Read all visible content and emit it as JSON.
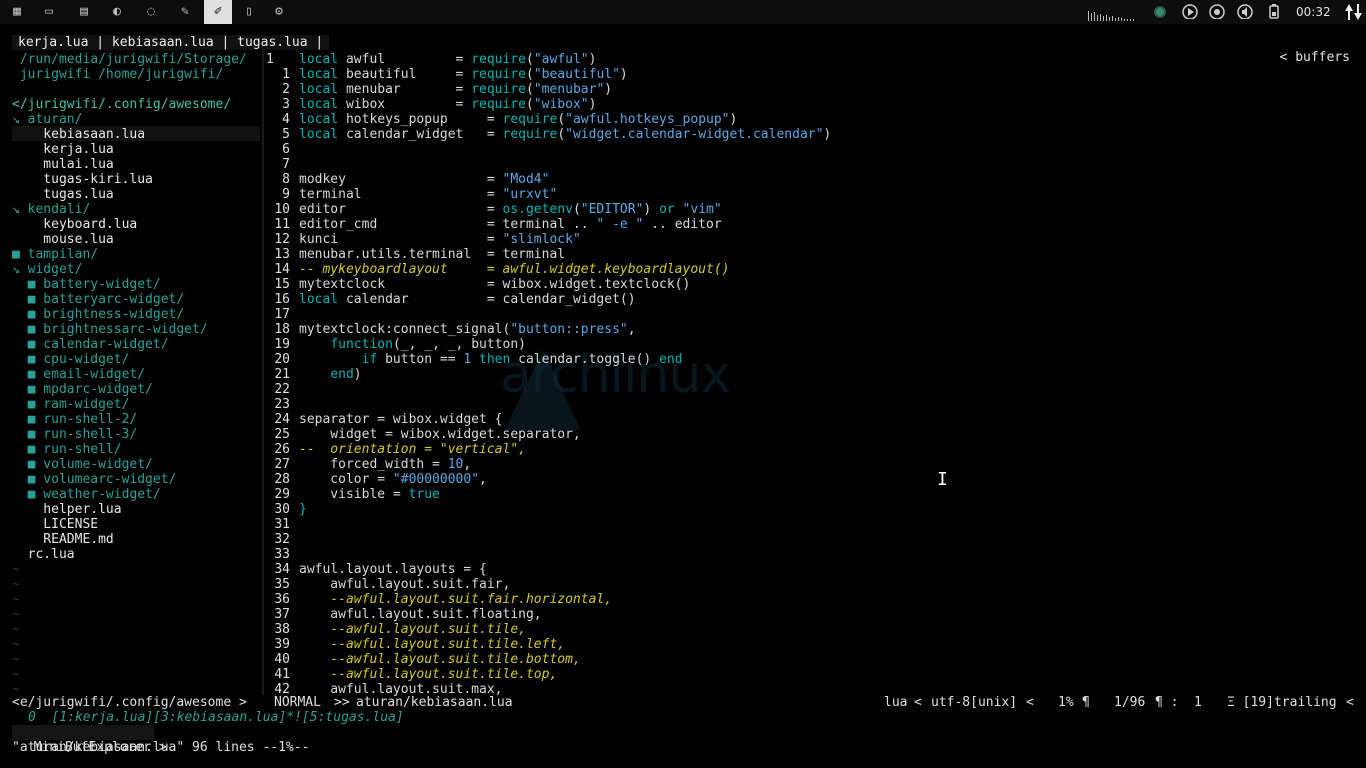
{
  "topbar": {
    "tags": [
      "grid-icon",
      "drive-icon",
      "film-icon",
      "chart-icon",
      "chat-icon",
      "brush-icon",
      "pen-icon",
      "document-icon",
      "gear-icon"
    ],
    "active_tag_index": 6,
    "clock": "00:32"
  },
  "tabline": {
    "tabs": "kerja.lua | kebiasaan.lua | tugas.lua |",
    "buffers": "buffers"
  },
  "tree": [
    {
      "text": " /run/media/jurigwifi/Storage/",
      "cls": "dir"
    },
    {
      "text": " jurigwifi /home/jurigwifi/",
      "cls": "dir"
    },
    {
      "text": "",
      "cls": "file"
    },
    {
      "text": "</jurigwifi/.config/awesome/",
      "cls": "root"
    },
    {
      "text": "↘ aturan/",
      "cls": "dir"
    },
    {
      "text": "    kebiasaan.lua",
      "cls": "file"
    },
    {
      "text": "    kerja.lua",
      "cls": "file"
    },
    {
      "text": "    mulai.lua",
      "cls": "file"
    },
    {
      "text": "    tugas-kiri.lua",
      "cls": "file"
    },
    {
      "text": "    tugas.lua",
      "cls": "file"
    },
    {
      "text": "↘ kendali/",
      "cls": "dir"
    },
    {
      "text": "    keyboard.lua",
      "cls": "file"
    },
    {
      "text": "    mouse.lua",
      "cls": "file"
    },
    {
      "text": "■ tampilan/",
      "cls": "dir"
    },
    {
      "text": "↘ widget/",
      "cls": "dir"
    },
    {
      "text": "  ■ battery-widget/",
      "cls": "dir"
    },
    {
      "text": "  ■ batteryarc-widget/",
      "cls": "dir"
    },
    {
      "text": "  ■ brightness-widget/",
      "cls": "dir"
    },
    {
      "text": "  ■ brightnessarc-widget/",
      "cls": "dir"
    },
    {
      "text": "  ■ calendar-widget/",
      "cls": "dir"
    },
    {
      "text": "  ■ cpu-widget/",
      "cls": "dir"
    },
    {
      "text": "  ■ email-widget/",
      "cls": "dir"
    },
    {
      "text": "  ■ mpdarc-widget/",
      "cls": "dir"
    },
    {
      "text": "  ■ ram-widget/",
      "cls": "dir"
    },
    {
      "text": "  ■ run-shell-2/",
      "cls": "dir"
    },
    {
      "text": "  ■ run-shell-3/",
      "cls": "dir"
    },
    {
      "text": "  ■ run-shell/",
      "cls": "dir"
    },
    {
      "text": "  ■ volume-widget/",
      "cls": "dir"
    },
    {
      "text": "  ■ volumearc-widget/",
      "cls": "dir"
    },
    {
      "text": "  ■ weather-widget/",
      "cls": "dir"
    },
    {
      "text": "    helper.lua",
      "cls": "file"
    },
    {
      "text": "    LICENSE",
      "cls": "file"
    },
    {
      "text": "    README.md",
      "cls": "file"
    },
    {
      "text": "  rc.lua",
      "cls": "file"
    },
    {
      "text": "~",
      "cls": "tilde"
    },
    {
      "text": "~",
      "cls": "tilde"
    },
    {
      "text": "~",
      "cls": "tilde"
    },
    {
      "text": "~",
      "cls": "tilde"
    },
    {
      "text": "~",
      "cls": "tilde"
    },
    {
      "text": "~",
      "cls": "tilde"
    },
    {
      "text": "~",
      "cls": "tilde"
    },
    {
      "text": "~",
      "cls": "tilde"
    },
    {
      "text": "~",
      "cls": "tilde"
    }
  ],
  "code": [
    {
      "ln": "1",
      "parts": [
        [
          "kw",
          "local"
        ],
        [
          "",
          " awful         = "
        ],
        [
          "kw",
          "require"
        ],
        [
          "",
          "("
        ],
        [
          "str",
          "\"awful\""
        ],
        [
          "",
          ")"
        ]
      ]
    },
    {
      "ln": "1",
      "parts": [
        [
          "kw",
          "local"
        ],
        [
          "",
          " beautiful     = "
        ],
        [
          "kw",
          "require"
        ],
        [
          "",
          "("
        ],
        [
          "str",
          "\"beautiful\""
        ],
        [
          "",
          ")"
        ]
      ]
    },
    {
      "ln": "2",
      "parts": [
        [
          "kw",
          "local"
        ],
        [
          "",
          " menubar       = "
        ],
        [
          "kw",
          "require"
        ],
        [
          "",
          "("
        ],
        [
          "str",
          "\"menubar\""
        ],
        [
          "",
          ")"
        ]
      ]
    },
    {
      "ln": "3",
      "parts": [
        [
          "kw",
          "local"
        ],
        [
          "",
          " wibox         = "
        ],
        [
          "kw",
          "require"
        ],
        [
          "",
          "("
        ],
        [
          "str",
          "\"wibox\""
        ],
        [
          "",
          ")"
        ]
      ]
    },
    {
      "ln": "4",
      "parts": [
        [
          "kw",
          "local"
        ],
        [
          "",
          " hotkeys_popup     = "
        ],
        [
          "kw",
          "require"
        ],
        [
          "",
          "("
        ],
        [
          "str",
          "\"awful.hotkeys_popup\""
        ],
        [
          "",
          ")"
        ]
      ]
    },
    {
      "ln": "5",
      "parts": [
        [
          "kw",
          "local"
        ],
        [
          "",
          " calendar_widget   = "
        ],
        [
          "kw",
          "require"
        ],
        [
          "",
          "("
        ],
        [
          "str",
          "\"widget.calendar-widget.calendar\""
        ],
        [
          "",
          ")"
        ]
      ]
    },
    {
      "ln": "6",
      "parts": []
    },
    {
      "ln": "7",
      "parts": []
    },
    {
      "ln": "8",
      "parts": [
        [
          "",
          "modkey                  = "
        ],
        [
          "str",
          "\"Mod4\""
        ]
      ]
    },
    {
      "ln": "9",
      "parts": [
        [
          "",
          "terminal                = "
        ],
        [
          "str",
          "\"urxvt\""
        ]
      ]
    },
    {
      "ln": "10",
      "parts": [
        [
          "",
          "editor                  = "
        ],
        [
          "kw",
          "os.getenv"
        ],
        [
          "",
          "("
        ],
        [
          "str",
          "\"EDITOR\""
        ],
        [
          "",
          ") "
        ],
        [
          "kw",
          "or"
        ],
        [
          "",
          " "
        ],
        [
          "str",
          "\"vim\""
        ]
      ]
    },
    {
      "ln": "11",
      "parts": [
        [
          "",
          "editor_cmd              = terminal .. "
        ],
        [
          "str",
          "\" -e \""
        ],
        [
          "",
          " .. editor"
        ]
      ]
    },
    {
      "ln": "12",
      "parts": [
        [
          "",
          "kunci                   = "
        ],
        [
          "str",
          "\"slimlock\""
        ]
      ]
    },
    {
      "ln": "13",
      "parts": [
        [
          "",
          "menubar.utils.terminal  = terminal"
        ]
      ]
    },
    {
      "ln": "14",
      "parts": [
        [
          "cm",
          "-- mykeyboardlayout     = awful.widget.keyboardlayout()"
        ]
      ]
    },
    {
      "ln": "15",
      "parts": [
        [
          "",
          "mytextclock             = wibox.widget.textclock()"
        ]
      ]
    },
    {
      "ln": "16",
      "parts": [
        [
          "kw",
          "local"
        ],
        [
          "",
          " calendar          = calendar_widget()"
        ]
      ]
    },
    {
      "ln": "17",
      "parts": []
    },
    {
      "ln": "18",
      "parts": [
        [
          "",
          "mytextclock:connect_signal("
        ],
        [
          "str",
          "\"button::press\""
        ],
        [
          "",
          ","
        ]
      ]
    },
    {
      "ln": "19",
      "parts": [
        [
          "",
          "    "
        ],
        [
          "kw",
          "function"
        ],
        [
          "",
          "(_, _, _, button)"
        ]
      ]
    },
    {
      "ln": "20",
      "parts": [
        [
          "",
          "        "
        ],
        [
          "kw",
          "if"
        ],
        [
          "",
          " button == "
        ],
        [
          "num",
          "1"
        ],
        [
          "",
          " "
        ],
        [
          "kw",
          "then"
        ],
        [
          "",
          " calendar.toggle() "
        ],
        [
          "kw",
          "end"
        ]
      ]
    },
    {
      "ln": "21",
      "parts": [
        [
          "",
          "    "
        ],
        [
          "kw",
          "end"
        ],
        [
          "",
          ")"
        ]
      ]
    },
    {
      "ln": "22",
      "parts": []
    },
    {
      "ln": "23",
      "parts": []
    },
    {
      "ln": "24",
      "parts": [
        [
          "",
          "separator = wibox.widget {"
        ]
      ]
    },
    {
      "ln": "25",
      "parts": [
        [
          "",
          "    widget = wibox.widget.separator,"
        ]
      ]
    },
    {
      "ln": "26",
      "parts": [
        [
          "cm",
          "--  orientation = \"vertical\","
        ]
      ]
    },
    {
      "ln": "27",
      "parts": [
        [
          "",
          "    forced_width = "
        ],
        [
          "num",
          "10"
        ],
        [
          "",
          ","
        ]
      ]
    },
    {
      "ln": "28",
      "parts": [
        [
          "",
          "    color = "
        ],
        [
          "str",
          "\"#00000000\""
        ],
        [
          "",
          ","
        ]
      ]
    },
    {
      "ln": "29",
      "parts": [
        [
          "",
          "    visible = "
        ],
        [
          "kw",
          "true"
        ]
      ]
    },
    {
      "ln": "30",
      "parts": [
        [
          "kw",
          "}"
        ]
      ]
    },
    {
      "ln": "31",
      "parts": []
    },
    {
      "ln": "32",
      "parts": []
    },
    {
      "ln": "33",
      "parts": []
    },
    {
      "ln": "34",
      "parts": [
        [
          "",
          "awful.layout.layouts = {"
        ]
      ]
    },
    {
      "ln": "35",
      "parts": [
        [
          "",
          "    awful.layout.suit.fair,"
        ]
      ]
    },
    {
      "ln": "36",
      "parts": [
        [
          "cm",
          "    --awful.layout.suit.fair.horizontal,"
        ]
      ]
    },
    {
      "ln": "37",
      "parts": [
        [
          "",
          "    awful.layout.suit.floating,"
        ]
      ]
    },
    {
      "ln": "38",
      "parts": [
        [
          "cm",
          "    --awful.layout.suit.tile,"
        ]
      ]
    },
    {
      "ln": "39",
      "parts": [
        [
          "cm",
          "    --awful.layout.suit.tile.left,"
        ]
      ]
    },
    {
      "ln": "40",
      "parts": [
        [
          "cm",
          "    --awful.layout.suit.tile.bottom,"
        ]
      ]
    },
    {
      "ln": "41",
      "parts": [
        [
          "cm",
          "    --awful.layout.suit.tile.top,"
        ]
      ]
    },
    {
      "ln": "42",
      "parts": [
        [
          "",
          "    awful.layout.suit.max,"
        ]
      ]
    }
  ],
  "watermark": "archlinux",
  "statusline": {
    "path": "<e/jurigwifi/.config/awesome >",
    "mode": "NORMAL",
    "file": "aturan/kebiasaan.lua",
    "filetype": "lua",
    "encoding": "utf-8[unix]",
    "percent": "1%",
    "position": "1/96",
    "column": "1",
    "trailing": "Ξ [19]trailing"
  },
  "minibuf": "0  [1:kerja.lua][3:kebiasaan.lua]*![5:tugas.lua]",
  "minibuf_title": "MiniBufExplorer",
  "message": "\"aturan/kebiasaan.lua\" 96 lines --1%--"
}
